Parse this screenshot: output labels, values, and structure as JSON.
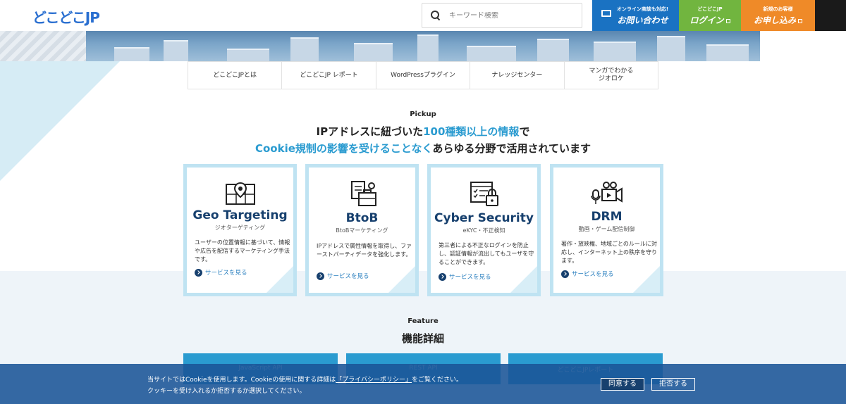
{
  "header": {
    "logo_text": "どこどこJP",
    "search": {
      "placeholder": "キーワード検索"
    },
    "contact": {
      "small": "オンライン商談も対応!",
      "big": "お問い合わせ"
    },
    "login": {
      "small": "どこどこJP",
      "big": "ログイン"
    },
    "apply": {
      "small": "新規のお客様",
      "big": "お申し込み"
    }
  },
  "nav": {
    "items": [
      "どこどこJPとは",
      "どこどこJP レポート",
      "WordPressプラグイン",
      "ナレッジセンター",
      "マンガでわかる\nジオロケ"
    ]
  },
  "pickup": {
    "label": "Pickup",
    "title1_pre": "IPアドレスに紐づいた",
    "title1_hl": "100種類以上の情報",
    "title1_post": "で",
    "title2_hl": "Cookie規制の影響を受けることなく",
    "title2_post": "あらゆる分野で活用されています",
    "cards": [
      {
        "title": "Geo Targeting",
        "sub": "ジオターゲティング",
        "desc": "ユーザーの位置情報に基づいて、情報や広告を配信するマーケティング手法です。",
        "link": "サービスを見る",
        "icon": "map-pin-icon"
      },
      {
        "title": "BtoB",
        "sub": "BtoBマーケティング",
        "desc": "IPアドレスで属性情報を取得し、ファーストパーティデータを強化します。",
        "link": "サービスを見る",
        "icon": "briefcase-icon"
      },
      {
        "title": "Cyber Security",
        "sub": "eKYC・不正検知",
        "desc": "第三者による不正なログインを防止し、認証情報が流出してもユーザを守ることができます。",
        "link": "サービスを見る",
        "icon": "lock-checklist-icon"
      },
      {
        "title": "DRM",
        "sub": "動画・ゲーム配信制御",
        "desc": "著作・放映権、地域ごとのルールに対応し、インターネット上の秩序を守ります。",
        "link": "サービスを見る",
        "icon": "video-camera-icon"
      }
    ]
  },
  "feature": {
    "label": "Feature",
    "title": "機能詳細",
    "buttons": [
      "JavaScript API",
      "REST API",
      "どこどこJPレポート"
    ]
  },
  "cookie": {
    "line1_pre": "当サイトではCookieを使用します。Cookieの使用に関する詳細は",
    "line1_link": "「プライバシーポリシー」",
    "line1_post": "をご覧ください。",
    "line2": "クッキーを受け入れるか拒否するか選択してください。",
    "accept": "同意する",
    "reject": "拒否する"
  },
  "colors": {
    "accent": "#2a9bd0",
    "navy": "#17406e",
    "contact": "#1a72c2",
    "login": "#71b53f",
    "apply": "#ef8a28"
  }
}
